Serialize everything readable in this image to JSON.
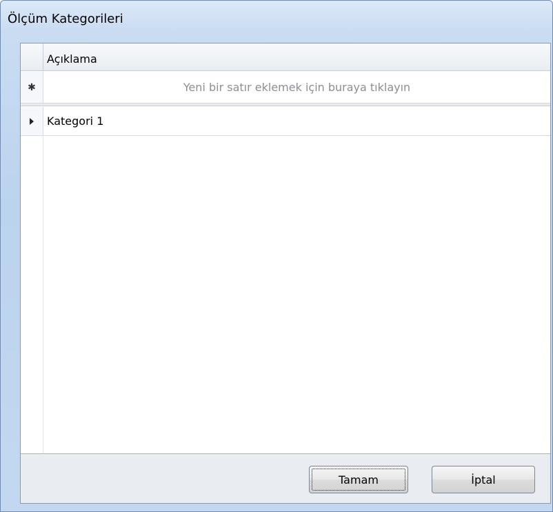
{
  "window": {
    "title": "Ölçüm Kategorileri"
  },
  "grid": {
    "column_header": "Açıklama",
    "new_row_indicator": "✱",
    "new_row_placeholder": "Yeni bir satır eklemek için buraya tıklayın",
    "rows": [
      {
        "description": "Kategori 1",
        "selected": true
      }
    ]
  },
  "buttons": {
    "ok_label": "Tamam",
    "cancel_label": "İptal"
  },
  "colors": {
    "title_bar": "#c3d8f0",
    "placeholder_text": "#8a8f96"
  }
}
